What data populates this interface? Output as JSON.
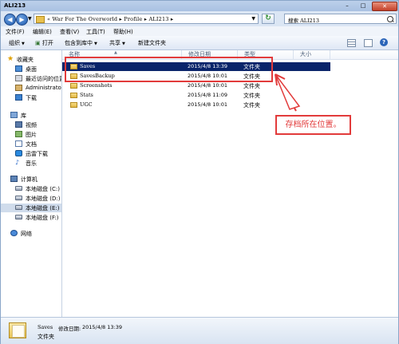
{
  "window": {
    "title": "ALI213",
    "minimize": "–",
    "maximize": "□",
    "close": "✕"
  },
  "address": {
    "path": "« War For The Overworld ▸ Profile ▸ ALI213 ▸",
    "search_text": "搜索 ALI213"
  },
  "menu": [
    "文件(F)",
    "编辑(E)",
    "查看(V)",
    "工具(T)",
    "帮助(H)"
  ],
  "toolbar": {
    "organize": "组织",
    "open": "打开",
    "include": "包含到库中",
    "share": "共享",
    "new_folder": "新建文件夹"
  },
  "sidebar": {
    "favorites": "收藏夹",
    "fav_items": [
      "桌面",
      "最近访问的位置",
      "Administrator",
      "下载"
    ],
    "libraries": "库",
    "lib_items": [
      "视频",
      "图片",
      "文档",
      "迅雷下载",
      "音乐"
    ],
    "computer": "计算机",
    "drives": [
      "本地磁盘 (C:)",
      "本地磁盘 (D:)",
      "本地磁盘 (E:)",
      "本地磁盘 (F:)"
    ],
    "network": "网络"
  },
  "columns": {
    "name": "名称",
    "date": "修改日期",
    "type": "类型",
    "size": "大小"
  },
  "files": [
    {
      "name": "Saves",
      "date": "2015/4/8 13:39",
      "type": "文件夹",
      "selected": true
    },
    {
      "name": "SavesBackup",
      "date": "2015/4/8 10:01",
      "type": "文件夹",
      "selected": false
    },
    {
      "name": "Screenshots",
      "date": "2015/4/8 10:01",
      "type": "文件夹",
      "selected": false
    },
    {
      "name": "Stats",
      "date": "2015/4/8 11:09",
      "type": "文件夹",
      "selected": false
    },
    {
      "name": "UGC",
      "date": "2015/4/8 10:01",
      "type": "文件夹",
      "selected": false
    }
  ],
  "callout": {
    "text": "存档所在位置。",
    "color": "#e23b3b"
  },
  "details": {
    "name": "Saves",
    "date_label": "修改日期:",
    "date": "2015/4/8 13:39",
    "type": "文件夹"
  }
}
